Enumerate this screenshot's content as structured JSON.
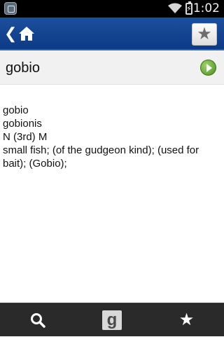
{
  "status_bar": {
    "time": "1:02",
    "icons": [
      "app-notification-icon",
      "wifi-icon",
      "battery-charging-icon"
    ]
  },
  "action_bar": {
    "back_glyph": "❮",
    "icons": [
      "back-icon",
      "home-icon",
      "star-icon"
    ]
  },
  "word": {
    "title": "gobio"
  },
  "definition": {
    "lines": [
      "gobio",
      "gobionis",
      "N (3rd) M",
      "small fish; (of the gudgeon kind); (used for bait); (Gobio);"
    ]
  },
  "bottom_bar": {
    "tabs": [
      "search-icon",
      "google-icon",
      "favorites-star-icon"
    ],
    "google_glyph": "g"
  },
  "colors": {
    "action_bar": "#0d3a86",
    "status_bar": "#000000",
    "bottom_bar": "#2a2a2a",
    "play": "#5ea52a"
  }
}
